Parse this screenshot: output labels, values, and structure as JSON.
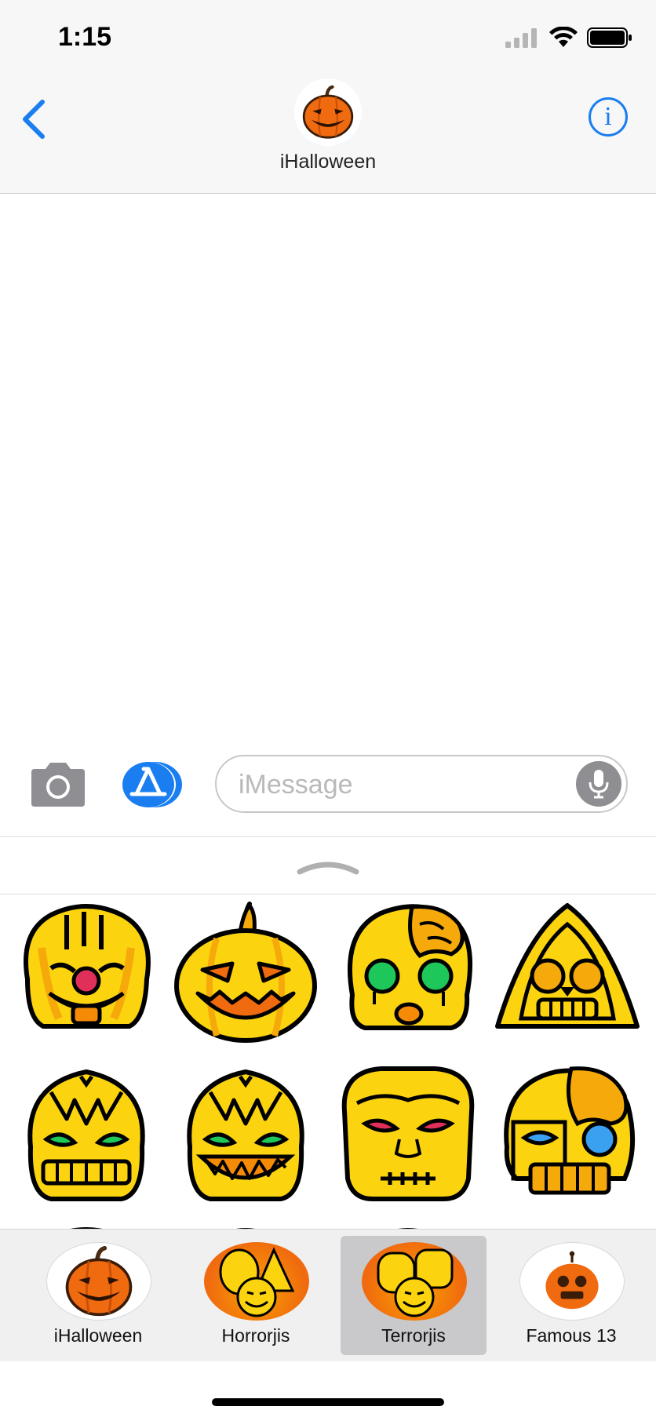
{
  "status_bar": {
    "time": "1:15"
  },
  "nav": {
    "contact_name": "iHalloween",
    "info_label": "i"
  },
  "composer": {
    "placeholder": "iMessage"
  },
  "app_tray": {
    "items": [
      {
        "label": "iHalloween",
        "selected": false
      },
      {
        "label": "Horrorjis",
        "selected": false
      },
      {
        "label": "Terrorjis",
        "selected": true
      },
      {
        "label": "Famous 13",
        "selected": false
      }
    ]
  },
  "stickers": [
    "clown-sticker",
    "pumpkin-sticker",
    "zombie-girl-sticker",
    "grim-reaper-sticker",
    "vampire-sticker",
    "vampire-grin-sticker",
    "frankenstein-sticker",
    "cyborg-zombie-sticker"
  ],
  "colors": {
    "accent": "#1a7ef0",
    "sticker_yellow": "#fcd30f",
    "sticker_orange": "#f58a07",
    "pumpkin_orange": "#f06a0f",
    "tray_selected": "#c9c9cc"
  }
}
